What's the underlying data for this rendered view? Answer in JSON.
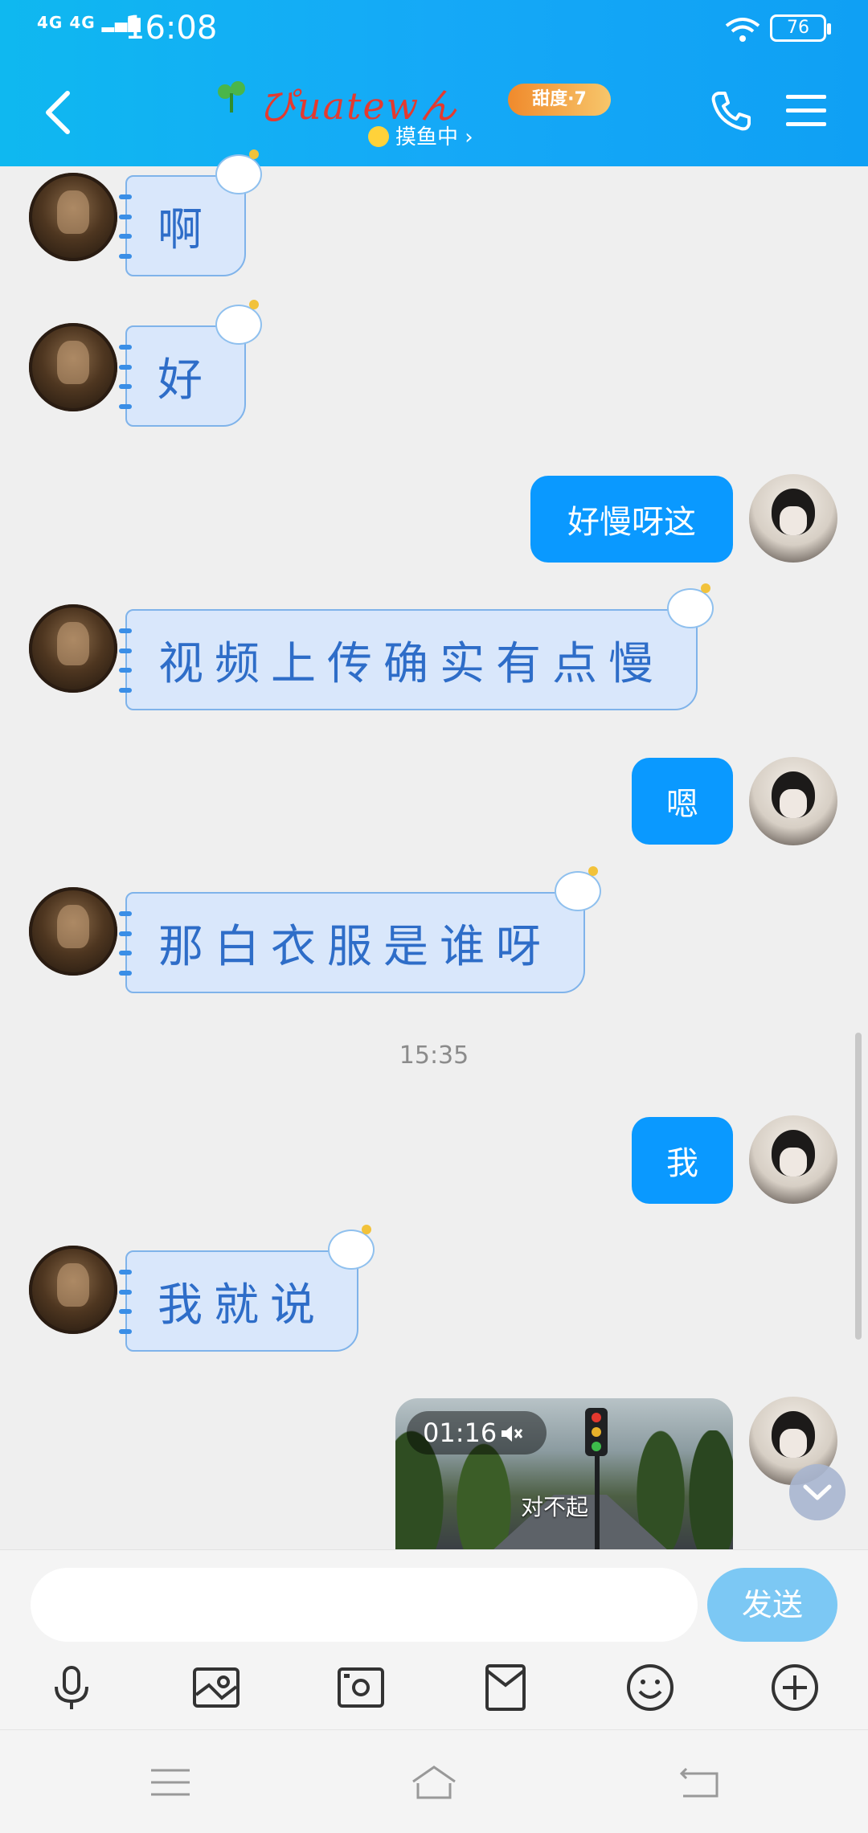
{
  "status_bar": {
    "signal_1": "4G",
    "signal_2": "4G",
    "time": "16:08",
    "battery": "76"
  },
  "header": {
    "contact_name": "ぴuatewん",
    "badge": "甜度·7",
    "presence": "摸鱼中 ›"
  },
  "messages": [
    {
      "side": "left",
      "text": "啊"
    },
    {
      "side": "left",
      "text": "好"
    },
    {
      "side": "right",
      "text": "好慢呀这"
    },
    {
      "side": "left",
      "text": "视频上传确实有点慢"
    },
    {
      "side": "right",
      "text": "嗯"
    },
    {
      "side": "left",
      "text": "那白衣服是谁呀"
    },
    {
      "side": "right",
      "text": "我"
    },
    {
      "side": "left",
      "text": "我就说"
    }
  ],
  "timestamp": "15:35",
  "video": {
    "duration": "01:16",
    "caption": "对不起"
  },
  "input": {
    "placeholder": "",
    "send_label": "发送"
  },
  "toolbar": [
    "microphone-icon",
    "image-icon",
    "camera-icon",
    "red-packet-icon",
    "emoji-icon",
    "plus-icon"
  ],
  "colors": {
    "header_start": "#0fb8f0",
    "header_end": "#0fa0f4",
    "bubble_right": "#0a99ff",
    "bubble_left": "#d9e7fb",
    "send_button": "#7cc8f4"
  }
}
